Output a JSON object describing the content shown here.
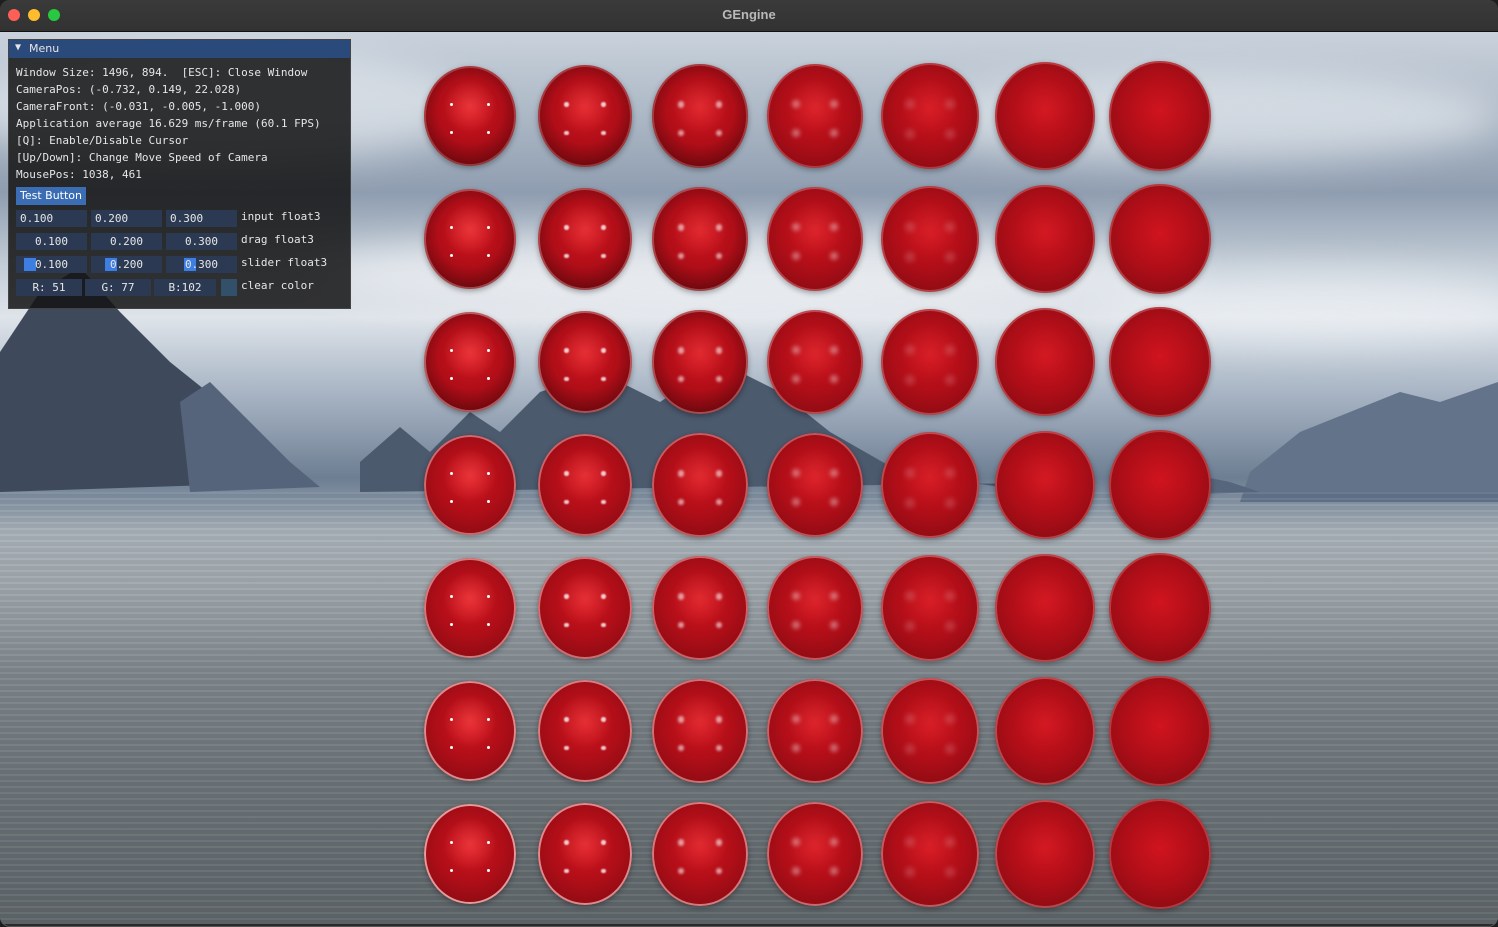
{
  "window": {
    "title": "GEngine"
  },
  "panel": {
    "header": "Menu",
    "lines": [
      "Window Size: 1496, 894.  [ESC]: Close Window",
      "CameraPos: (-0.732, 0.149, 22.028)",
      "CameraFront: (-0.031, -0.005, -1.000)",
      "Application average 16.629 ms/frame (60.1 FPS)",
      "[Q]: Enable/Disable Cursor",
      "[Up/Down]: Change Move Speed of Camera",
      "MousePos: 1038, 461"
    ],
    "test_button": "Test Button",
    "input_float3": {
      "label": "input float3",
      "values": [
        "0.100",
        "0.200",
        "0.300"
      ]
    },
    "drag_float3": {
      "label": "drag float3",
      "values": [
        "0.100",
        "0.200",
        "0.300"
      ]
    },
    "slider_float3": {
      "label": "slider float3",
      "values": [
        "0.100",
        "0.200",
        "0.300"
      ]
    },
    "clear_color": {
      "label": "clear color",
      "values": [
        "R: 51",
        "G: 77",
        "B:102"
      ]
    }
  },
  "scene": {
    "sphere_color": "#c0101a",
    "rows": 7,
    "cols": 7
  }
}
